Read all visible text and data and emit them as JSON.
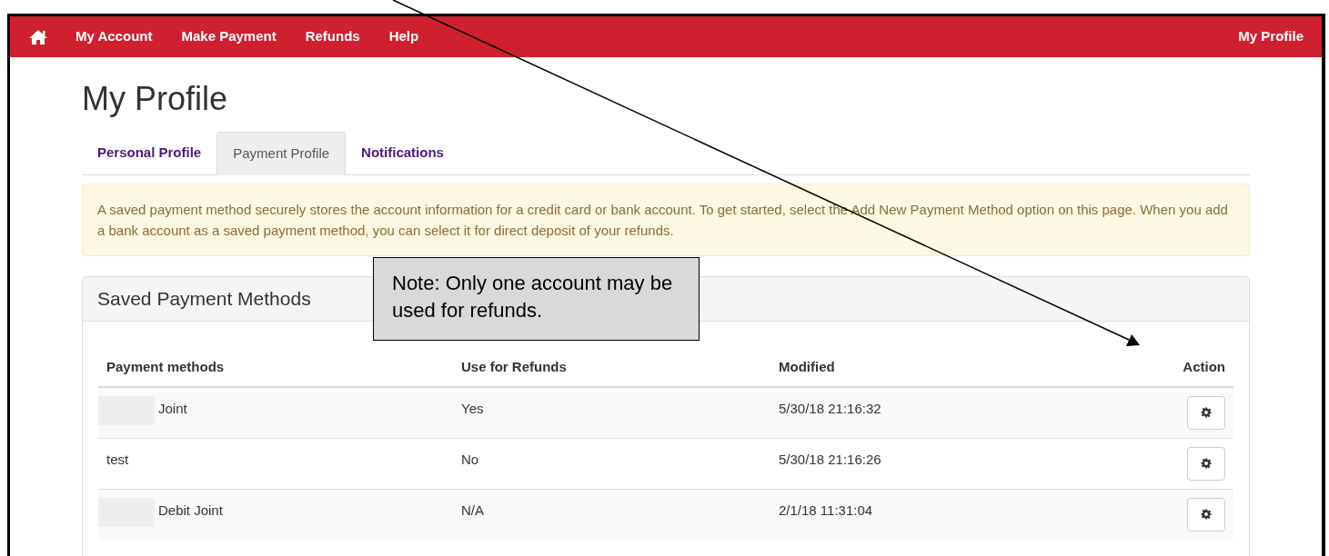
{
  "nav": {
    "items": [
      "My Account",
      "Make Payment",
      "Refunds",
      "Help"
    ],
    "right": "My Profile"
  },
  "page_title": "My Profile",
  "tabs": [
    {
      "label": "Personal Profile",
      "selected": false
    },
    {
      "label": "Payment Profile",
      "selected": true
    },
    {
      "label": "Notifications",
      "selected": false
    }
  ],
  "alert": "A saved payment method securely stores the account information for a credit card or bank account. To get started, select the Add New Payment Method option on this page. When you add a bank account as a saved payment method, you can select it for direct deposit of your refunds.",
  "panel": {
    "title": "Saved Payment Methods",
    "table": {
      "columns": [
        "Payment methods",
        "Use for Refunds",
        "Modified",
        "Action"
      ],
      "rows": [
        {
          "name": "Joint",
          "redacted": true,
          "use_for_refunds": "Yes",
          "modified": "5/30/18 21:16:32"
        },
        {
          "name": "test",
          "redacted": false,
          "use_for_refunds": "No",
          "modified": "5/30/18 21:16:26"
        },
        {
          "name": "Debit Joint",
          "redacted": true,
          "use_for_refunds": "N/A",
          "modified": "2/1/18 11:31:04"
        }
      ]
    }
  },
  "note": "Note:  Only one account may be used for refunds."
}
